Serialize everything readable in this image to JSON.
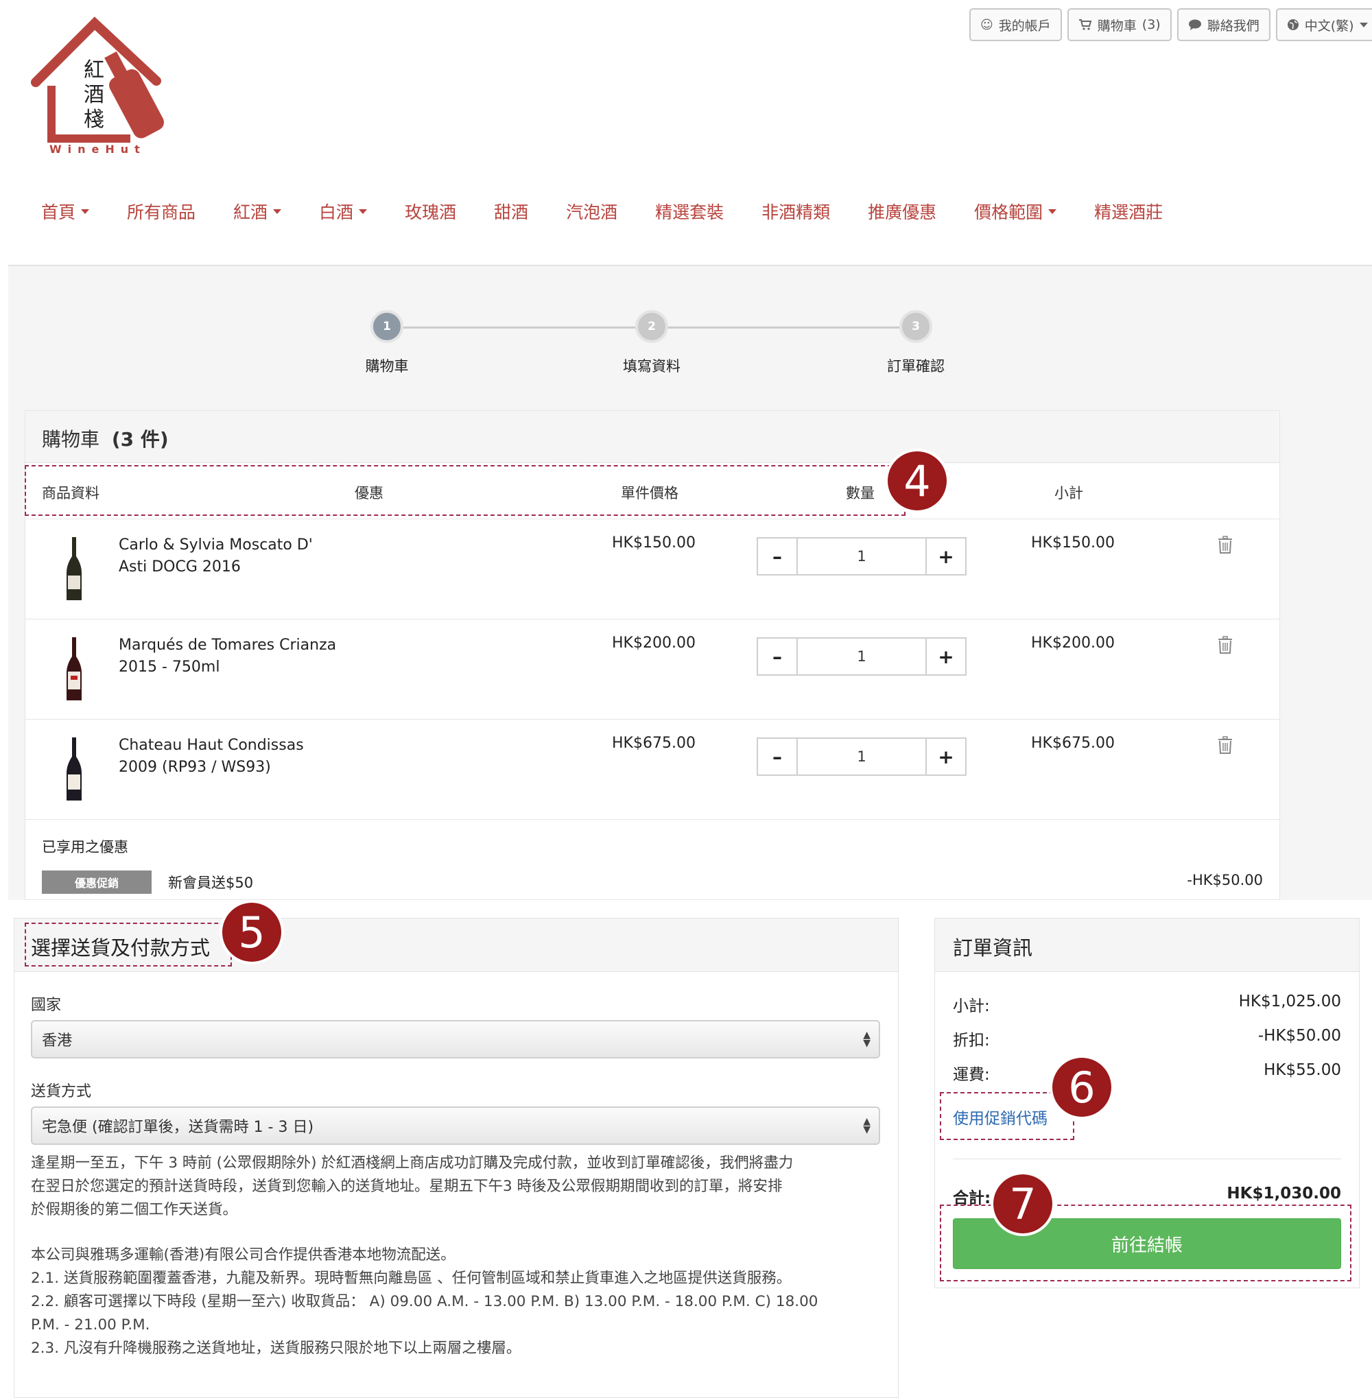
{
  "topbar": {
    "account": "我的帳戶",
    "cart": "購物車",
    "cart_count": "(3)",
    "contact": "聯絡我們",
    "language": "中文(繁)"
  },
  "logo": {
    "chars": [
      "紅",
      "酒",
      "棧"
    ],
    "brand": "WineHut"
  },
  "nav": [
    {
      "label": "首頁",
      "dropdown": true
    },
    {
      "label": "所有商品",
      "dropdown": false
    },
    {
      "label": "紅酒",
      "dropdown": true
    },
    {
      "label": "白酒",
      "dropdown": true
    },
    {
      "label": "玫瑰酒",
      "dropdown": false
    },
    {
      "label": "甜酒",
      "dropdown": false
    },
    {
      "label": "汽泡酒",
      "dropdown": false
    },
    {
      "label": "精選套裝",
      "dropdown": false
    },
    {
      "label": "非酒精類",
      "dropdown": false
    },
    {
      "label": "推廣優惠",
      "dropdown": false
    },
    {
      "label": "價格範圍",
      "dropdown": true
    },
    {
      "label": "精選酒莊",
      "dropdown": false
    }
  ],
  "steps": [
    {
      "num": "1",
      "label": "購物車"
    },
    {
      "num": "2",
      "label": "填寫資料"
    },
    {
      "num": "3",
      "label": "訂單確認"
    }
  ],
  "cart": {
    "title": "購物車",
    "count": "(3 件)",
    "columns": {
      "product": "商品資料",
      "offer": "優惠",
      "unit_price": "單件價格",
      "quantity": "數量",
      "subtotal": "小計"
    },
    "items": [
      {
        "name_l1": "Carlo & Sylvia Moscato D'",
        "name_l2": "Asti DOCG 2016",
        "price": "HK$150.00",
        "qty": "1",
        "subtotal": "HK$150.00",
        "bottle_color": "#2a2a1e"
      },
      {
        "name_l1": "Marqués de Tomares Crianza",
        "name_l2": "2015 - 750ml",
        "price": "HK$200.00",
        "qty": "1",
        "subtotal": "HK$200.00",
        "bottle_color": "#3a1414"
      },
      {
        "name_l1": "Chateau Haut Condissas",
        "name_l2": "2009 (RP93 / WS93)",
        "price": "HK$675.00",
        "qty": "1",
        "subtotal": "HK$675.00",
        "bottle_color": "#1e1a24"
      }
    ],
    "applied_label": "已享用之優惠",
    "promo_badge": "優惠促銷",
    "promo_name": "新會員送$50",
    "promo_amount": "-HK$50.00"
  },
  "shipping": {
    "title": "選擇送貨及付款方式",
    "country_label": "國家",
    "country_value": "香港",
    "method_label": "送貨方式",
    "method_value": "宅急便 (確認訂單後，送貨需時 1 - 3 日)",
    "desc_lines": [
      "逢星期一至五，下午 3 時前 (公眾假期除外) 於紅酒棧網上商店成功訂購及完成付款，並收到訂單確認後，我們將盡力",
      "在翌日於您選定的預計送貨時段，送貨到您輸入的送貨地址。星期五下午3 時後及公眾假期期間收到的訂單，將安排",
      "於假期後的第二個工作天送貨。"
    ],
    "notes": [
      "本公司與雅瑪多運輸(香港)有限公司合作提供香港本地物流配送。",
      "2.1. 送貨服務範圍覆蓋香港，九龍及新界。現時暫無向離島區 、任何管制區域和禁止貨車進入之地區提供送貨服務。",
      "2.2. 顧客可選擇以下時段 (星期一至六) 收取貨品：  A) 09.00 A.M. - 13.00 P.M. B) 13.00 P.M. - 18.00 P.M. C) 18.00",
      "P.M. - 21.00 P.M.",
      "2.3. 凡沒有升降機服務之送貨地址，送貨服務只限於地下以上兩層之樓層。"
    ]
  },
  "order": {
    "title": "訂單資訊",
    "subtotal_label": "小計:",
    "subtotal_value": "HK$1,025.00",
    "discount_label": "折扣:",
    "discount_value": "-HK$50.00",
    "shipping_label": "運費:",
    "shipping_value": "HK$55.00",
    "coupon_link": "使用促銷代碼",
    "total_label": "合計:",
    "total_value": "HK$1,030.00",
    "checkout_label": "前往結帳"
  },
  "annotations": [
    "4",
    "5",
    "6",
    "7"
  ],
  "colors": {
    "brand_red": "#b8443e",
    "checkout_green": "#5cb85c",
    "annotation_red": "#9b1a1c",
    "link_blue": "#2d6ab0"
  }
}
